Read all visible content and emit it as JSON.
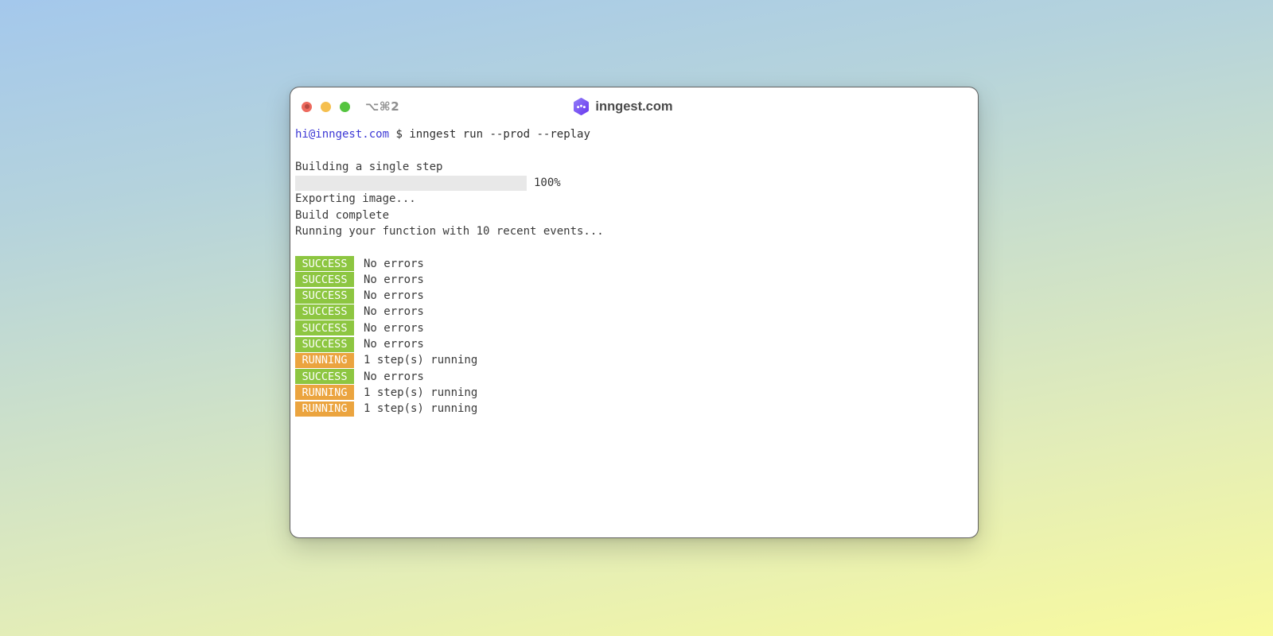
{
  "background": {
    "gradient_corners": {
      "top_left": "#a4c8ec",
      "top_right": "#b5d3dc",
      "bottom_left": "#e3edb8",
      "bottom_right": "#f9fa9e"
    }
  },
  "window": {
    "title": "inngest.com",
    "shortcut_label": "⌥⌘2",
    "traffic_lights": {
      "close": "#ed6a5e",
      "minimize": "#f5bf4f",
      "zoom": "#55c43f"
    },
    "logo_color": "#7a52f4"
  },
  "terminal": {
    "prompt": {
      "user": "hi@inngest.com",
      "symbol": "$",
      "command": "inngest run --prod --replay",
      "user_color": "#3c38d5"
    },
    "build": {
      "label": "Building a single step",
      "percent": 100,
      "percent_label": "100%",
      "bar_gradient": [
        "#4c36c0",
        "#e47ff5"
      ]
    },
    "output_lines": [
      "Exporting image...",
      "Build complete",
      "Running your function with 10 recent events..."
    ],
    "results": [
      {
        "status": "SUCCESS",
        "message": "No errors"
      },
      {
        "status": "SUCCESS",
        "message": "No errors"
      },
      {
        "status": "SUCCESS",
        "message": "No errors"
      },
      {
        "status": "SUCCESS",
        "message": "No errors"
      },
      {
        "status": "SUCCESS",
        "message": "No errors"
      },
      {
        "status": "SUCCESS",
        "message": "No errors"
      },
      {
        "status": "RUNNING",
        "message": "1 step(s) running"
      },
      {
        "status": "SUCCESS",
        "message": "No errors"
      },
      {
        "status": "RUNNING",
        "message": "1 step(s) running"
      },
      {
        "status": "RUNNING",
        "message": "1 step(s) running"
      }
    ],
    "status_colors": {
      "SUCCESS": "#8dc641",
      "RUNNING": "#eba43f"
    }
  }
}
